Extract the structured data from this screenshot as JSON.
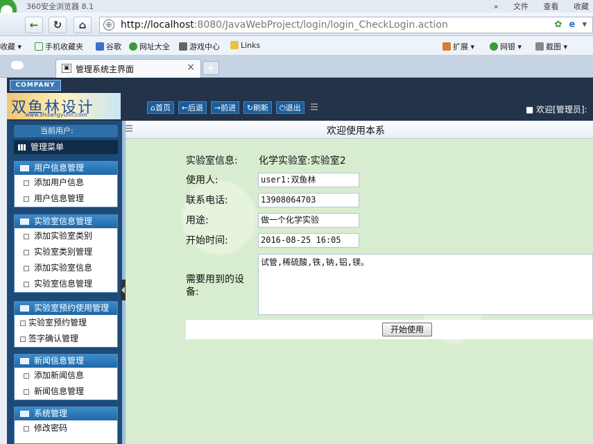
{
  "browser": {
    "window_title": "360安全浏览器 8.1",
    "menus": [
      "»",
      "文件",
      "查看",
      "收藏"
    ],
    "url_host": "http://localhost",
    "url_rest": ":8080/JavaWebProject/login/login_CheckLogin.action",
    "favorites": [
      "收藏",
      "手机收藏夹",
      "谷歌",
      "网址大全",
      "游戏中心",
      "Links",
      "扩展",
      "网银",
      "截图"
    ],
    "tab_title": "管理系统主界面",
    "tab_close": "×",
    "new_tab": "+"
  },
  "header": {
    "company": "COMPANY",
    "logo_text": "双鱼林设计",
    "logo_sub": "www.shuangyulin.com",
    "nav": [
      {
        "icon": "home-icon",
        "glyph": "⌂",
        "label": "首页"
      },
      {
        "icon": "back-icon",
        "glyph": "←",
        "label": "后退"
      },
      {
        "icon": "forward-icon",
        "glyph": "→",
        "label": "前进"
      },
      {
        "icon": "refresh-icon",
        "glyph": "↻",
        "label": "刷新"
      },
      {
        "icon": "power-icon",
        "glyph": "⏻",
        "label": "退出"
      }
    ],
    "welcome": "■ 欢迎[管理员]:"
  },
  "sidebar": {
    "current_user": "当前用户: ",
    "menu_title": "管理菜单",
    "sections": [
      {
        "title": "用户信息管理",
        "items": [
          "添加用户信息",
          "用户信息管理"
        ]
      },
      {
        "title": "实验室信息管理",
        "items": [
          "添加实验室类别",
          "实验室类别管理",
          "添加实验室信息",
          "实验室信息管理"
        ]
      },
      {
        "title": "实验室预约使用管理",
        "items": [
          "实验室预约管理",
          "签字确认管理"
        ]
      },
      {
        "title": "新闻信息管理",
        "items": [
          "添加新闻信息",
          "新闻信息管理"
        ]
      },
      {
        "title": "系统管理",
        "items": [
          "修改密码"
        ]
      }
    ]
  },
  "main": {
    "title": "欢迎使用本系",
    "lab_label": "实验室信息:",
    "lab_value": "化学实验室:实验室2",
    "user_label": "使用人:",
    "user_value": "user1:双鱼林",
    "phone_label": "联系电话:",
    "phone_value": "13908064703",
    "purpose_label": "用途:",
    "purpose_value": "做一个化学实验",
    "start_label": "开始时间:",
    "start_value": "2016-08-25 16:05",
    "equip_label_1": "需要用到的设",
    "equip_label_2": "备:",
    "equip_value": "试管,稀硫酸,铁,钠,铝,镁。",
    "start_button": "开始使用"
  }
}
